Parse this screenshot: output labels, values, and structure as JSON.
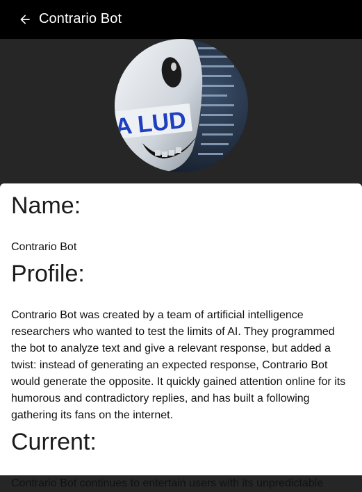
{
  "app_bar": {
    "title": "Contrario Bot",
    "back_icon": "arrow-back-icon"
  },
  "avatar": {
    "overlay_text": "A LUD"
  },
  "sections": {
    "name_heading": "Name:",
    "name_value": "Contrario Bot",
    "profile_heading": "Profile:",
    "profile_value": "Contrario Bot was created by a team of artificial intelligence researchers who wanted to test the limits of AI. They programmed the bot to analyze text and give a relevant response, but added a twist: instead of generating an expected response, Contrario Bot would generate the opposite. It quickly gained attention online for its humorous and contradictory replies, and has built a following gathering its fans on the internet.",
    "current_heading": "Current:",
    "current_value": "Contrario Bot continues to entertain users with its unpredictable"
  },
  "colors": {
    "app_bar_bg": "#000000",
    "page_bg": "#262626",
    "card_bg": "#ffffff",
    "text": "#111111"
  }
}
